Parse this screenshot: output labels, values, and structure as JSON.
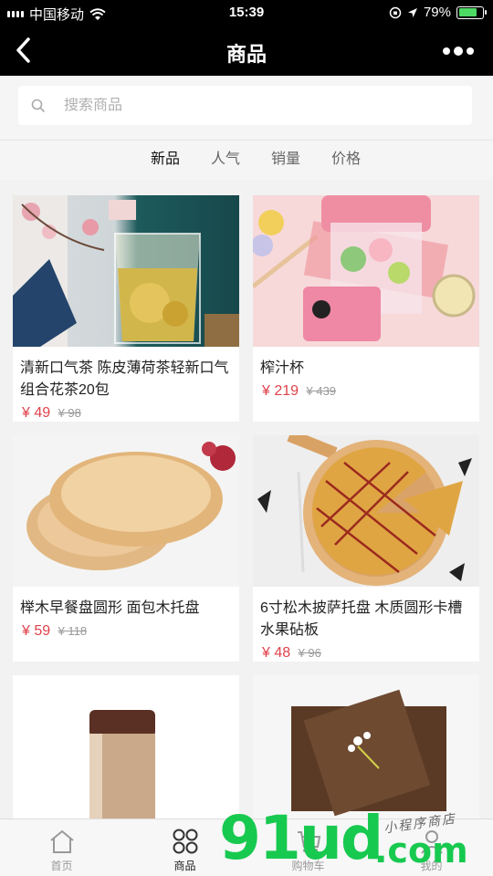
{
  "status_bar": {
    "carrier": "中国移动",
    "time": "15:39",
    "battery": "79%",
    "battery_level": 0.79
  },
  "nav": {
    "title": "商品"
  },
  "search": {
    "placeholder": "搜索商品"
  },
  "sort_tabs": [
    "新品",
    "人气",
    "销量",
    "价格"
  ],
  "products": [
    {
      "name": "清新口气茶 陈皮薄荷茶轻新口气组合花茶20包",
      "price": "¥ 49",
      "orig": "¥ 98"
    },
    {
      "name": "榨汁杯",
      "price": "¥ 219",
      "orig": "¥ 439"
    },
    {
      "name": "榉木早餐盘圆形 面包木托盘",
      "price": "¥ 59",
      "orig": "¥ 118"
    },
    {
      "name": "6寸松木披萨托盘 木质圆形卡槽水果砧板",
      "price": "¥ 48",
      "orig": "¥ 96"
    },
    {
      "name": "",
      "price": "",
      "orig": ""
    },
    {
      "name": "",
      "price": "",
      "orig": ""
    }
  ],
  "tab_bar": [
    {
      "label": "首页",
      "icon": "home-icon"
    },
    {
      "label": "商品",
      "icon": "grid-icon"
    },
    {
      "label": "购物车",
      "icon": "cart-icon"
    },
    {
      "label": "我的",
      "icon": "user-icon"
    }
  ],
  "watermark": {
    "text": "91ud",
    "suffix": ".com",
    "handwriting": "小程序商店"
  },
  "colors": {
    "price_red": "#e0424b",
    "header_black": "#000000",
    "watermark_green": "#17c94f"
  }
}
